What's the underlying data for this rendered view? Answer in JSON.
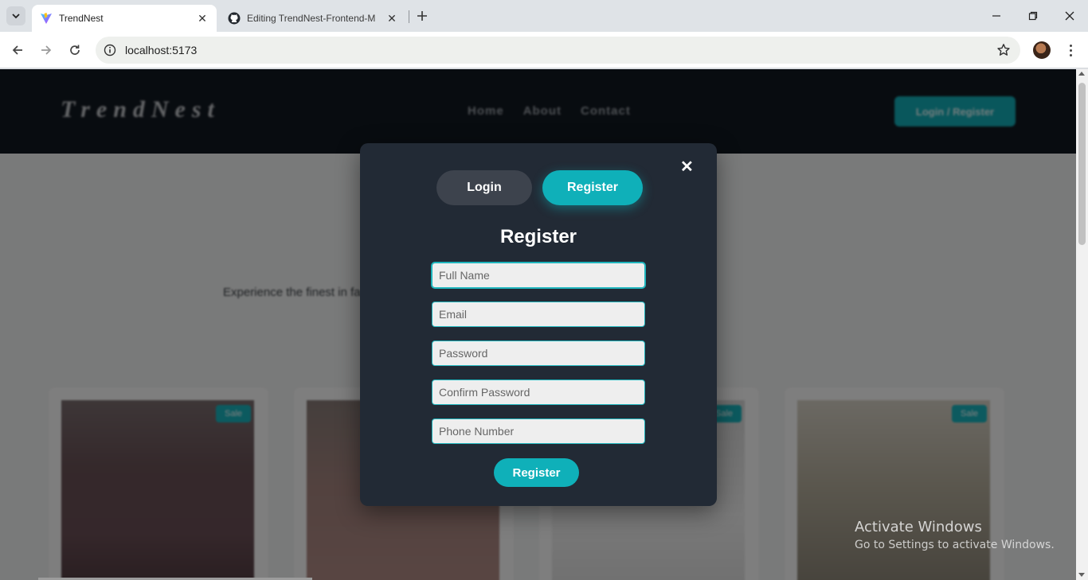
{
  "browser": {
    "tabs": [
      {
        "title": "TrendNest",
        "active": true,
        "favicon": "vite-icon"
      },
      {
        "title": "Editing TrendNest-Frontend-M",
        "active": false,
        "favicon": "github-icon"
      }
    ],
    "url": "localhost:5173"
  },
  "site": {
    "logo": "TrendNest",
    "nav": [
      "Home",
      "About",
      "Contact"
    ],
    "header_button": "Login / Register",
    "hero_text": "Experience the finest in fashion and lifestyle, curated for modern trends — where",
    "badge": "Sale"
  },
  "modal": {
    "tab_login": "Login",
    "tab_register": "Register",
    "title": "Register",
    "close": "✕",
    "fields": {
      "full_name": "Full Name",
      "email": "Email",
      "password": "Password",
      "confirm_password": "Confirm Password",
      "phone": "Phone Number"
    },
    "submit": "Register"
  },
  "watermark": {
    "title": "Activate Windows",
    "subtitle": "Go to Settings to activate Windows."
  },
  "colors": {
    "accent": "#0fb0b9",
    "modal_bg": "#222a35",
    "header_bg": "#111820"
  }
}
